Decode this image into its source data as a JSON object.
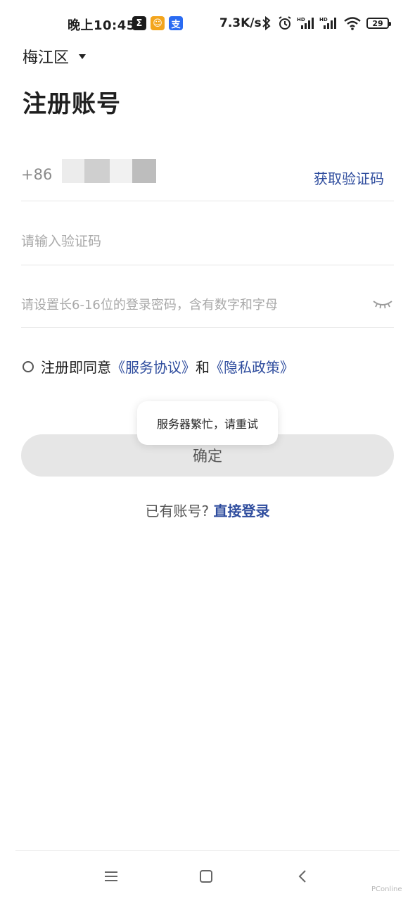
{
  "status_bar": {
    "time": "晚上10:45",
    "apps": [
      {
        "glyph": "Σ",
        "color": "#1b1b1b"
      },
      {
        "glyph": "☺",
        "color": "#f3a51d"
      },
      {
        "glyph": "支",
        "color": "#2a6bf2"
      }
    ],
    "speed": "7.3K/s",
    "battery": "29",
    "icons": [
      "bluetooth-icon",
      "alarm-icon",
      "signal-hd-icon",
      "signal-hd-icon",
      "wifi-icon",
      "battery-icon"
    ]
  },
  "location": {
    "label": "梅江区"
  },
  "page_title": "注册账号",
  "phone": {
    "country_code": "+86",
    "get_code_label": "获取验证码"
  },
  "code_field": {
    "placeholder": "请输入验证码"
  },
  "password_field": {
    "placeholder": "请设置长6-16位的登录密码，含有数字和字母"
  },
  "agreement": {
    "prefix": "注册即同意",
    "service_link": "《服务协议》",
    "and": "和",
    "privacy_link": "《隐私政策》"
  },
  "toast": {
    "message": "服务器繁忙，请重试"
  },
  "confirm_label": "确定",
  "login": {
    "prompt": "已有账号?",
    "link": "直接登录"
  },
  "watermark": "PConline",
  "colors": {
    "accent": "#2f4d9e",
    "button_bg": "#e6e6e6"
  }
}
